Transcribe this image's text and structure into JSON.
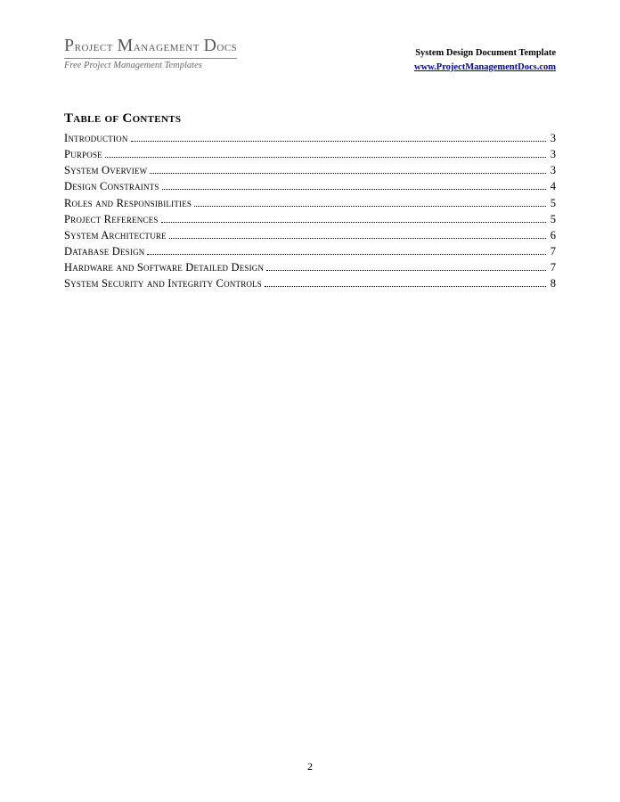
{
  "header": {
    "brand_title_html": "Project Management Docs",
    "brand_subtitle": "Free Project Management Templates",
    "doc_title": "System Design Document Template",
    "doc_link": "www.ProjectManagementDocs.com"
  },
  "toc": {
    "heading": "Table of Contents",
    "entries": [
      {
        "label": "Introduction",
        "page": "3"
      },
      {
        "label": "Purpose",
        "page": "3"
      },
      {
        "label": "System Overview",
        "page": "3"
      },
      {
        "label": "Design Constraints",
        "page": "4"
      },
      {
        "label": "Roles and Responsibilities",
        "page": "5"
      },
      {
        "label": "Project References",
        "page": "5"
      },
      {
        "label": "System Architecture",
        "page": "6"
      },
      {
        "label": "Database Design",
        "page": "7"
      },
      {
        "label": "Hardware and Software Detailed Design",
        "page": "7"
      },
      {
        "label": "System Security and Integrity Controls",
        "page": "8"
      }
    ]
  },
  "page_number": "2"
}
